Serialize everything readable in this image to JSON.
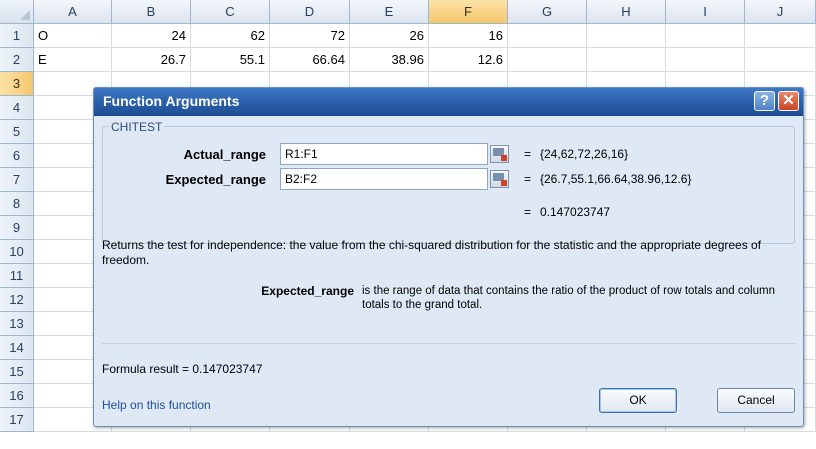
{
  "grid": {
    "columns": [
      "A",
      "B",
      "C",
      "D",
      "E",
      "F",
      "G",
      "H",
      "I",
      "J"
    ],
    "selected_column": "F",
    "rows": [
      "1",
      "2",
      "3",
      "4",
      "5",
      "6",
      "7",
      "8",
      "9",
      "10",
      "11",
      "12",
      "13",
      "14",
      "15",
      "16",
      "17"
    ],
    "selected_row": "3",
    "row1": {
      "a": "O",
      "b": "24",
      "c": "62",
      "d": "72",
      "e": "26",
      "f": "16"
    },
    "row2": {
      "a": "E",
      "b": "26.7",
      "c": "55.1",
      "d": "66.64",
      "e": "38.96",
      "f": "12.6"
    }
  },
  "dialog": {
    "title": "Function Arguments",
    "help_icon": "?",
    "close_icon": "✕",
    "function_name": "CHITEST",
    "args": [
      {
        "label": "Actual_range",
        "value": "R1:F1",
        "result": "{24,62,72,26,16}"
      },
      {
        "label": "Expected_range",
        "value": "B2:F2",
        "result": "{26.7,55.1,66.64,38.96,12.6}"
      }
    ],
    "equals": "=",
    "function_result": "0.147023747",
    "description": "Returns the test for independence: the value from the chi-squared distribution for the statistic and the appropriate degrees of freedom.",
    "param_name": "Expected_range",
    "param_description": "is the range of data that contains the ratio of the product of row totals and column totals to the grand total.",
    "formula_result_label": "Formula result =",
    "formula_result_value": "0.147023747",
    "help_link": "Help on this function",
    "ok_label": "OK",
    "cancel_label": "Cancel"
  }
}
